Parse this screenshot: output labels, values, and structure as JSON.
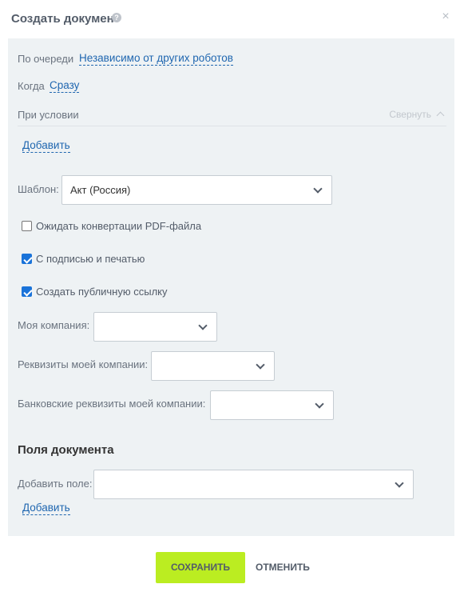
{
  "dialog": {
    "title": "Создать документ",
    "help_icon": "?",
    "close_icon": "×"
  },
  "settings": {
    "queue_label": "По очереди",
    "queue_value": "Независимо от других роботов",
    "when_label": "Когда",
    "when_value": "Сразу",
    "condition_label": "При условии",
    "collapse_label": "Свернуть",
    "add_label": "Добавить"
  },
  "template": {
    "label": "Шаблон:",
    "value": "Акт (Россия)"
  },
  "checkboxes": [
    {
      "label": "Ожидать конвертации PDF-файла",
      "checked": false
    },
    {
      "label": "С подписью и печатью",
      "checked": true
    },
    {
      "label": "Создать публичную ссылку",
      "checked": true
    }
  ],
  "company": {
    "my_company_label": "Моя компания:",
    "my_company_value": "",
    "requisites_label": "Реквизиты моей компании:",
    "requisites_value": "",
    "bank_label": "Банковские реквизиты моей компании:",
    "bank_value": ""
  },
  "document_fields": {
    "title": "Поля документа",
    "add_field_label": "Добавить поле:",
    "add_field_value": "",
    "add_label": "Добавить"
  },
  "footer": {
    "save_label": "СОХРАНИТЬ",
    "cancel_label": "ОТМЕНИТЬ"
  },
  "colors": {
    "save_button": "#bbed21",
    "link": "#2067b0",
    "panel_bg": "#eef2f4",
    "checkbox_checked": "#1a73d9"
  }
}
